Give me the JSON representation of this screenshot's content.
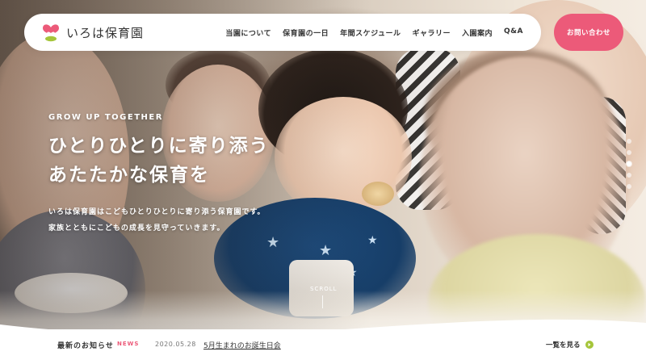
{
  "brand": {
    "name": "いろは保育園",
    "colors": {
      "accent": "#ec5a79",
      "leaf": "#a5c53a",
      "text": "#333333"
    }
  },
  "nav": {
    "items": [
      {
        "label": "当園について"
      },
      {
        "label": "保育園の一日"
      },
      {
        "label": "年間スケジュール"
      },
      {
        "label": "ギャラリー"
      },
      {
        "label": "入園案内"
      },
      {
        "label": "Q&A"
      }
    ]
  },
  "contact": {
    "label": "お問い合わせ"
  },
  "hero": {
    "eyebrow": "GROW UP TOGETHER",
    "title_line1": "ひとりひとりに寄り添う",
    "title_line2": "あたたかな保育を",
    "sub_line1": "いろは保育園はこどもひとりひとりに寄り添う保育園です。",
    "sub_line2": "家族とともにこどもの成長を見守っていきます。",
    "scroll_label": "SCROLL",
    "slides": {
      "count": 5,
      "active_index": 2
    }
  },
  "news": {
    "title": "最新のお知らせ",
    "title_en": "NEWS",
    "date": "2020.05.28",
    "headline": "5月生まれのお誕生日会",
    "more_label": "一覧を見る"
  }
}
